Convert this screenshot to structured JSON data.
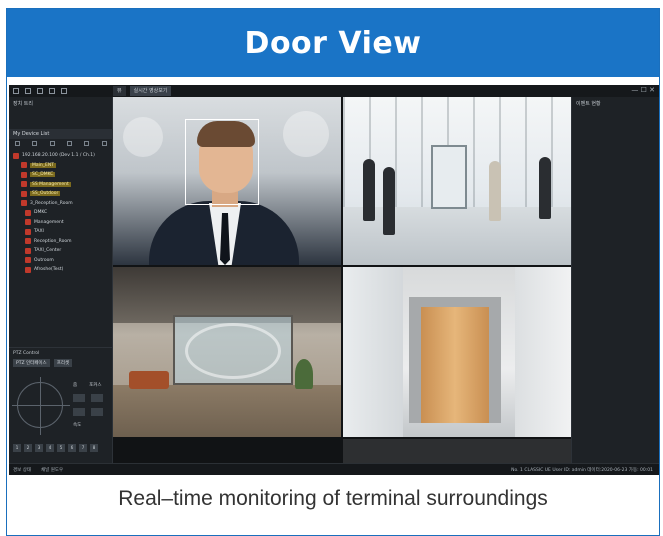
{
  "banner": {
    "title": "Door View"
  },
  "app": {
    "tabs": [
      "뷰",
      "실시간 영상보기"
    ],
    "sidebar": {
      "panel_title": "장치 트리",
      "section_header": "My Device List",
      "items": [
        {
          "label": "192.168.20.100 (Dev 1.1 / Ch.1)",
          "highlight": false
        },
        {
          "label": "Main_ENT",
          "highlight": true
        },
        {
          "label": "SC_DMKC",
          "highlight": true
        },
        {
          "label": "SS Management",
          "highlight": true
        },
        {
          "label": "SS_Outdoor",
          "highlight": true
        },
        {
          "label": "3_Reception_Room",
          "highlight": false
        },
        {
          "label": "DMKC",
          "highlight": false
        },
        {
          "label": "Management",
          "highlight": false
        },
        {
          "label": "TAXI",
          "highlight": false
        },
        {
          "label": "Reception_Room",
          "highlight": false
        },
        {
          "label": "TAXI_Center",
          "highlight": false
        },
        {
          "label": "Outroom",
          "highlight": false
        },
        {
          "label": "Afroshe(Test)",
          "highlight": false
        }
      ]
    },
    "ptz": {
      "header": "PTZ Control",
      "label": "PTZ 인터페이스",
      "button": "프리셋",
      "zoom_label": "줌",
      "focus_label": "포커스",
      "speed_label": "속도",
      "presets": [
        "1",
        "2",
        "3",
        "4",
        "5",
        "6",
        "7",
        "8"
      ]
    },
    "right_panel": {
      "title": "이벤트 현황"
    },
    "status": {
      "left": [
        "경보 상태",
        "채널 원도우"
      ],
      "right": "No. 1 CLASSIC UE   User ID: admin   데이터:2020-06-23   가동: 00:01"
    }
  },
  "caption": "Real–time monitoring of terminal surroundings"
}
